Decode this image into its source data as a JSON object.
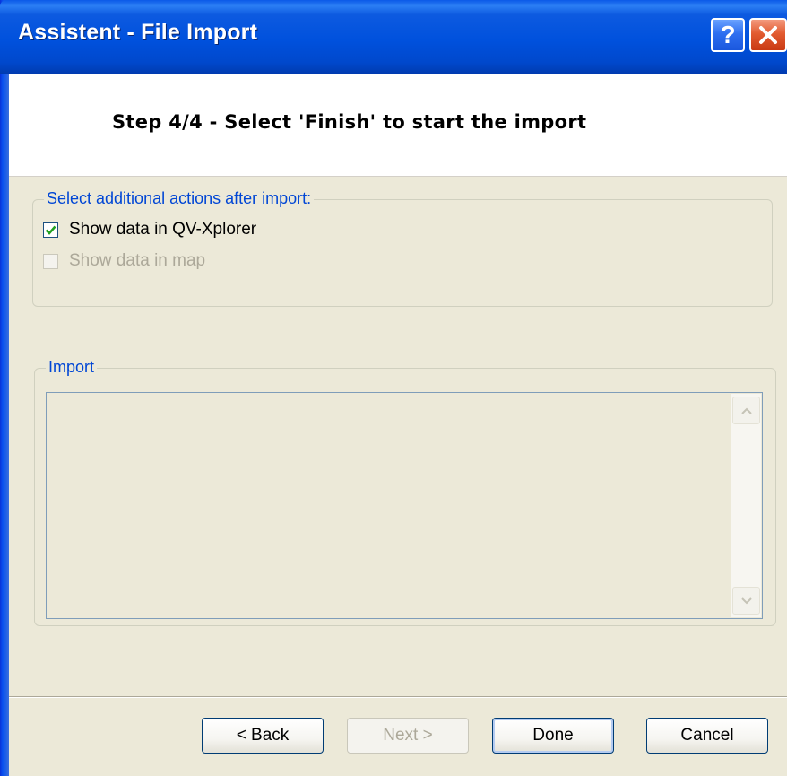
{
  "window": {
    "title": "Assistent - File Import",
    "help_glyph": "?",
    "close_icon": "close-icon"
  },
  "header": {
    "step_title": "Step 4/4 - Select 'Finish' to start the import"
  },
  "actions_group": {
    "legend": "Select additional actions after import:",
    "options": [
      {
        "label": "Show data in QV-Xplorer",
        "checked": true,
        "enabled": true
      },
      {
        "label": "Show data in map",
        "checked": false,
        "enabled": false
      }
    ]
  },
  "import_group": {
    "legend": "Import",
    "log_text": ""
  },
  "buttons": {
    "back": "< Back",
    "next": "Next >",
    "done": "Done",
    "cancel": "Cancel"
  },
  "colors": {
    "titlebar": "#0051dd",
    "accent_text": "#0046d5",
    "checkmark": "#21a121",
    "dialog_bg": "#ece9d8"
  }
}
